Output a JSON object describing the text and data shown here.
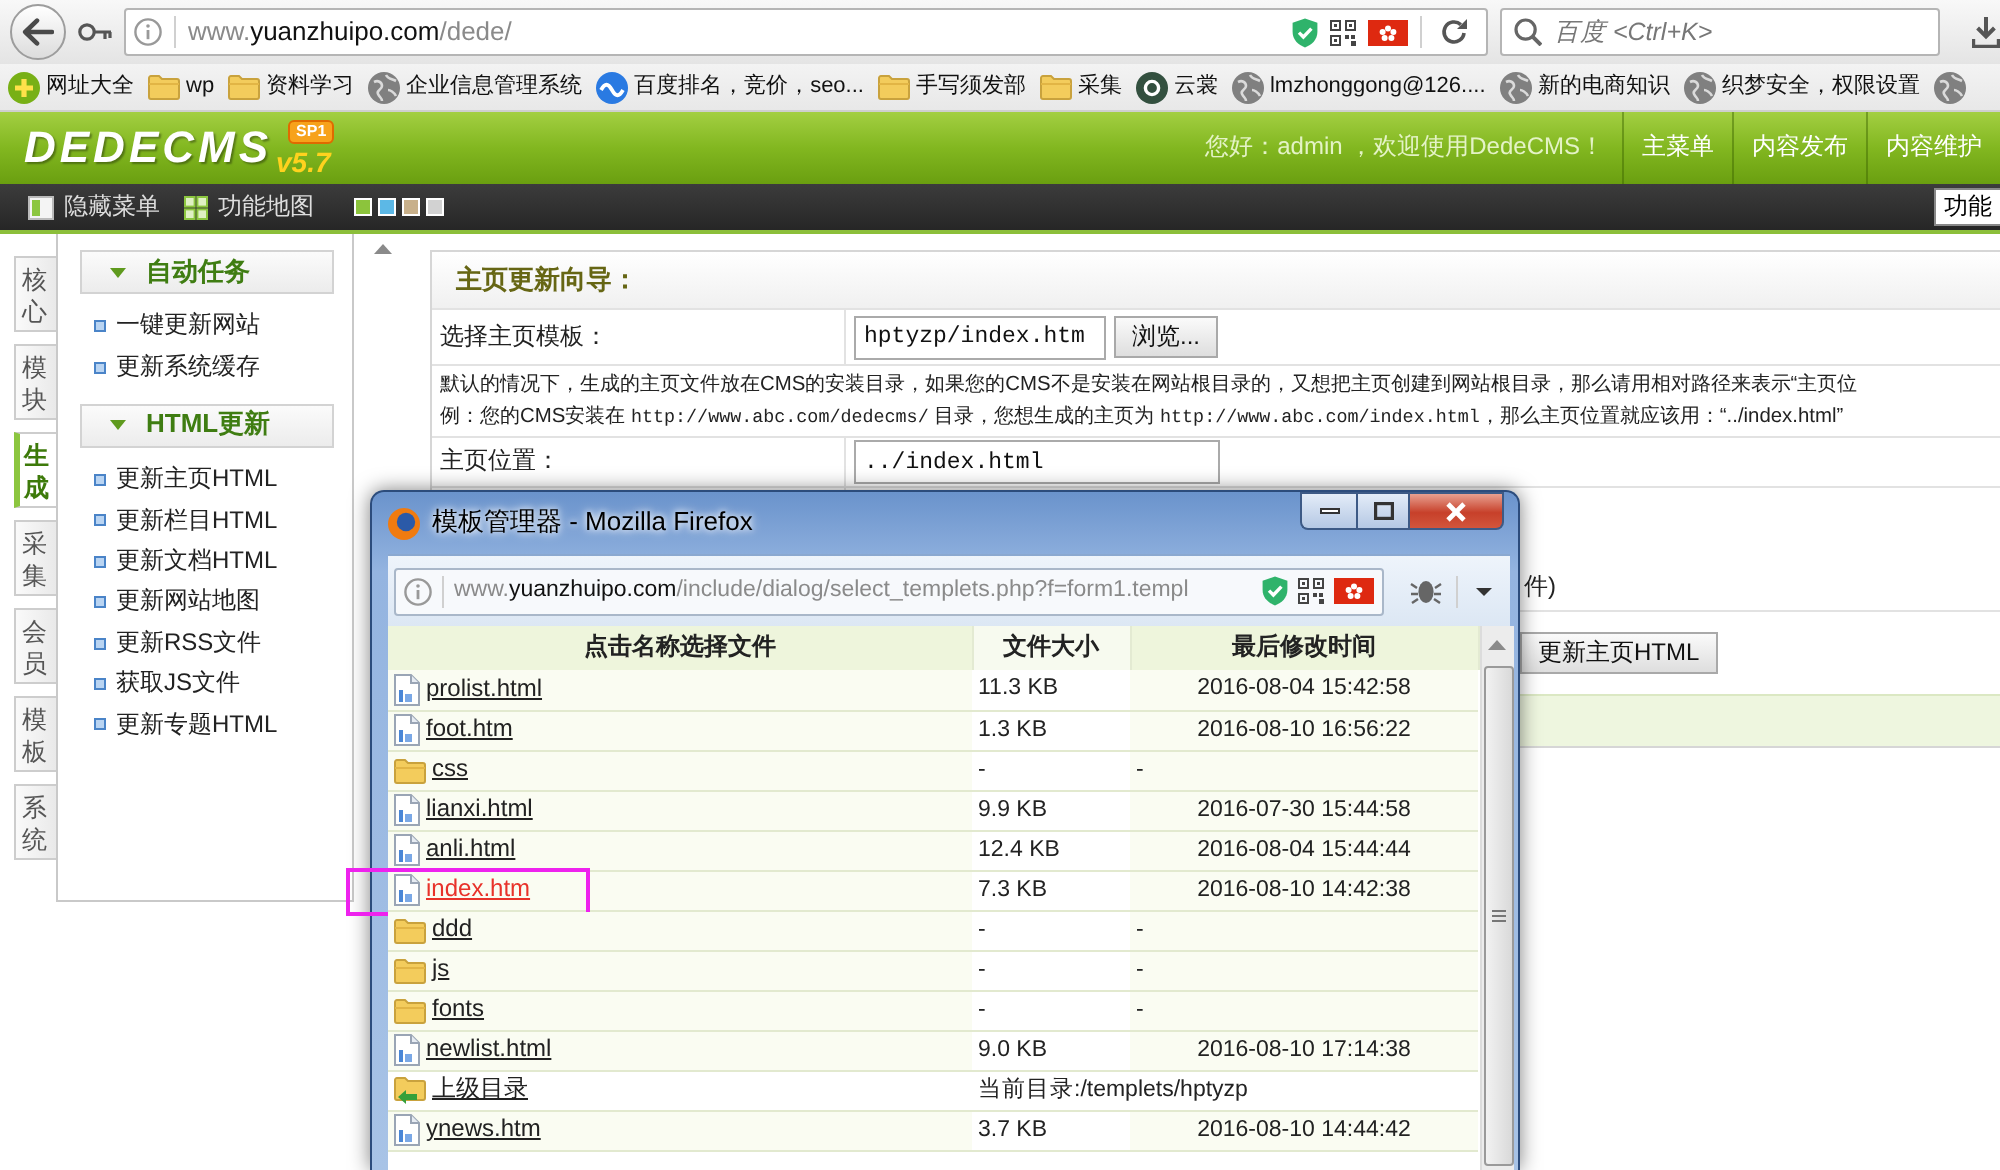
{
  "browser": {
    "url": {
      "prefix": "www.",
      "domain": "yuanzhuipo.com",
      "path": "/dede/"
    },
    "search": {
      "placeholder": "百度 <Ctrl+K>"
    }
  },
  "bookmarks": [
    {
      "kind": "plus",
      "label": "网址大全"
    },
    {
      "kind": "folder",
      "label": "wp"
    },
    {
      "kind": "folder",
      "label": "资料学习"
    },
    {
      "kind": "globe",
      "label": "企业信息管理系统"
    },
    {
      "kind": "wave",
      "label": "百度排名，竞价，seo..."
    },
    {
      "kind": "folder",
      "label": "手写须发部"
    },
    {
      "kind": "folder",
      "label": "采集"
    },
    {
      "kind": "badge",
      "label": "云裳"
    },
    {
      "kind": "globe",
      "label": "lmzhonggong@126...."
    },
    {
      "kind": "globe",
      "label": "新的电商知识"
    },
    {
      "kind": "globe",
      "label": "织梦安全，权限设置"
    },
    {
      "kind": "globe"
    }
  ],
  "cms_header": {
    "logo": "DEDECMS",
    "edition": "SP1",
    "version": "v5.7",
    "greeting": "您好：admin ，欢迎使用DedeCMS！",
    "menu": [
      "主菜单",
      "内容发布",
      "内容维护"
    ]
  },
  "toolbar": {
    "items": [
      {
        "kind": "panel",
        "label": "隐藏菜单"
      },
      {
        "kind": "grid",
        "label": "功能地图"
      }
    ],
    "skins": [
      {
        "color": "#8cc43c"
      },
      {
        "color": "#5cb8e6"
      },
      {
        "color": "#c8b08a"
      },
      {
        "color": "#d2d2d2"
      }
    ],
    "search_button": "功能"
  },
  "side_tabs": [
    {
      "label": "核心",
      "selected": false
    },
    {
      "label": "模块",
      "selected": false
    },
    {
      "label": "生成",
      "selected": true
    },
    {
      "label": "采集",
      "selected": false
    },
    {
      "label": "会员",
      "selected": false
    },
    {
      "label": "模板",
      "selected": false
    },
    {
      "label": "系统",
      "selected": false
    }
  ],
  "menu_sections": [
    {
      "title": "自动任务",
      "items": [
        "一键更新网站",
        "更新系统缓存"
      ]
    },
    {
      "title": "HTML更新",
      "items": [
        "更新主页HTML",
        "更新栏目HTML",
        "更新文档HTML",
        "更新网站地图",
        "更新RSS文件",
        "获取JS文件",
        "更新专题HTML"
      ]
    }
  ],
  "main": {
    "title": "主页更新向导：",
    "rows": [
      {
        "kind": "field",
        "label": "选择主页模板：",
        "value": "hptyzp/index.htm",
        "button": "浏览..."
      },
      {
        "kind": "note",
        "lines": [
          [
            {
              "kind": "text",
              "text": "默认的情况下，生成的主页文件放在CMS的安装目录，如果您的CMS不是安装在网站根目录的，又想把主页创建到网站根目录，那么请用相对路径来表示“主页位"
            }
          ],
          [
            {
              "kind": "text",
              "text": "例：您的CMS安装在 "
            },
            {
              "kind": "code",
              "text": "http://www.abc.com/dedecms/"
            },
            {
              "kind": "text",
              "text": " 目录，您想生成的主页为 "
            },
            {
              "kind": "code",
              "text": "http://www.abc.com/index.html"
            },
            {
              "kind": "text",
              "text": "，那么主页位置就应该用：“../index.html”"
            }
          ]
        ]
      },
      {
        "kind": "field",
        "label": "主页位置：",
        "value": "../index.html"
      },
      {
        "kind": "text",
        "text": "件)"
      },
      {
        "kind": "action",
        "button": "更新主页HTML"
      },
      {
        "kind": "bar"
      }
    ]
  },
  "dialog": {
    "title": "模板管理器 - Mozilla Firefox",
    "url": {
      "prefix": "www.",
      "domain": "yuanzhuipo.com",
      "path": "/include/dialog/select_templets.php?f=form1.templ"
    },
    "columns": [
      "点击名称选择文件",
      "文件大小",
      "最后修改时间"
    ],
    "rows": [
      {
        "kind": "file",
        "name": "prolist.html",
        "size": "11.3 KB",
        "modified": "2016-08-04 15:42:58",
        "highlighted": false
      },
      {
        "kind": "file",
        "name": "foot.htm",
        "size": "1.3 KB",
        "modified": "2016-08-10 16:56:22",
        "highlighted": false
      },
      {
        "kind": "folder",
        "name": "css",
        "size": "-",
        "modified": "-",
        "highlighted": false
      },
      {
        "kind": "file",
        "name": "lianxi.html",
        "size": "9.9 KB",
        "modified": "2016-07-30 15:44:58",
        "highlighted": false
      },
      {
        "kind": "file",
        "name": "anli.html",
        "size": "12.4 KB",
        "modified": "2016-08-04 15:44:44",
        "highlighted": false
      },
      {
        "kind": "file",
        "name": "index.htm",
        "size": "7.3 KB",
        "modified": "2016-08-10 14:42:38",
        "highlighted": true
      },
      {
        "kind": "folder",
        "name": "ddd",
        "size": "-",
        "modified": "-",
        "highlighted": false
      },
      {
        "kind": "folder",
        "name": "js",
        "size": "-",
        "modified": "-",
        "highlighted": false
      },
      {
        "kind": "folder",
        "name": "fonts",
        "size": "-",
        "modified": "-",
        "highlighted": false
      },
      {
        "kind": "file",
        "name": "newlist.html",
        "size": "9.0 KB",
        "modified": "2016-08-10 17:14:38",
        "highlighted": false
      },
      {
        "kind": "parent",
        "name": "上级目录",
        "location": "当前目录:/templets/hptyzp",
        "highlighted": false
      },
      {
        "kind": "file",
        "name": "ynews.htm",
        "size": "3.7 KB",
        "modified": "2016-08-10 14:44:42",
        "highlighted": false
      }
    ]
  }
}
